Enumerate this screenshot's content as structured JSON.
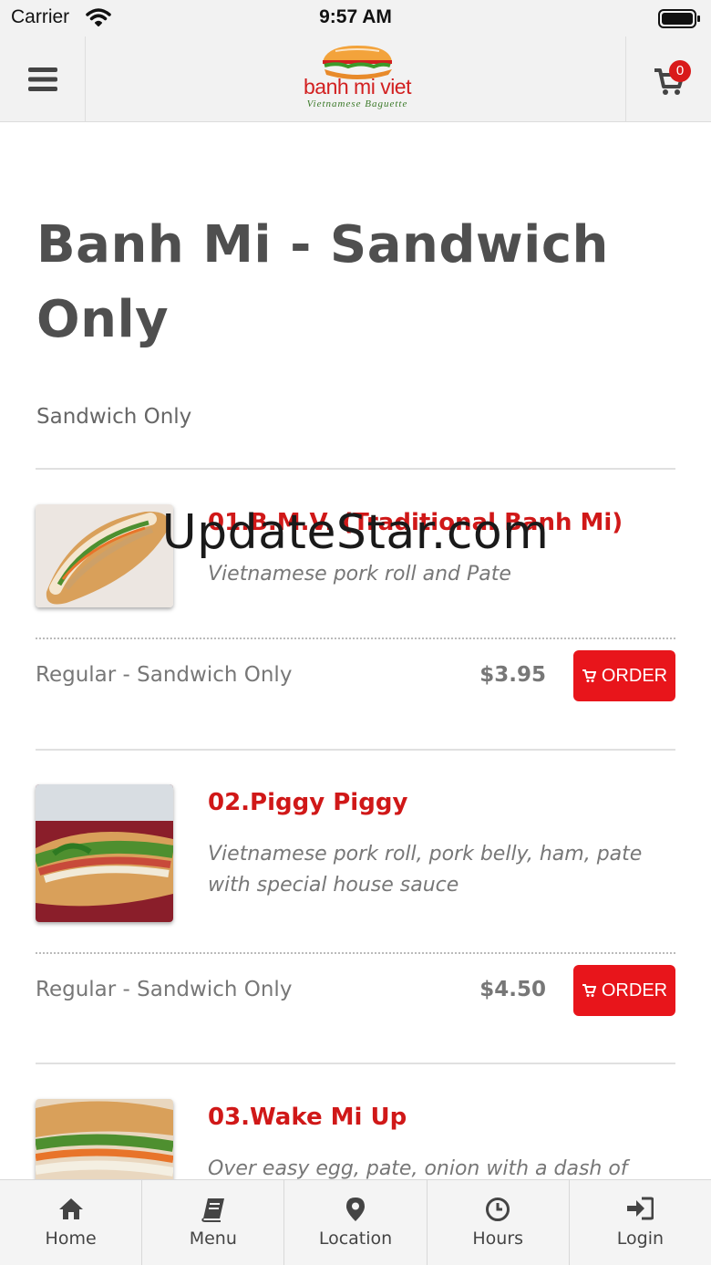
{
  "status_bar": {
    "carrier": "Carrier",
    "time": "9:57 AM"
  },
  "header": {
    "logo_name": "banh mi viet",
    "logo_tagline": "Vietnamese Baguette",
    "cart_count": "0"
  },
  "page": {
    "title": "Banh Mi - Sandwich Only",
    "subtitle": "Sandwich Only"
  },
  "items": [
    {
      "name": "01.B.M.V. (Traditional Banh Mi)",
      "description": "Vietnamese pork roll and Pate",
      "size": "Regular - Sandwich Only",
      "price": "$3.95",
      "order_label": "ORDER"
    },
    {
      "name": "02.Piggy Piggy",
      "description": "Vietnamese pork roll, pork belly, ham, pate with special house sauce",
      "size": "Regular - Sandwich Only",
      "price": "$4.50",
      "order_label": "ORDER"
    },
    {
      "name": "03.Wake Mi Up",
      "description": "Over easy egg, pate, onion with a dash of soy"
    }
  ],
  "watermark": "UpdateStar.com",
  "tabs": [
    {
      "label": "Home",
      "icon": "home-icon"
    },
    {
      "label": "Menu",
      "icon": "book-icon"
    },
    {
      "label": "Location",
      "icon": "map-pin-icon"
    },
    {
      "label": "Hours",
      "icon": "clock-icon"
    },
    {
      "label": "Login",
      "icon": "sign-in-icon"
    }
  ],
  "colors": {
    "accent": "#e8151b",
    "item_name": "#d01818",
    "title": "#4f4f4f"
  }
}
